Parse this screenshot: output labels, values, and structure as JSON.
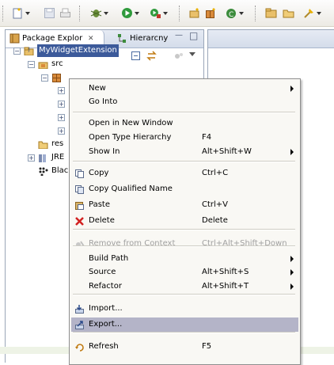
{
  "toolbar": {
    "icons": [
      "new-wizard-icon",
      "save-icon",
      "print-icon",
      "debug-icon",
      "run-icon",
      "external-tools-icon",
      "new-java-project-icon",
      "new-package-icon",
      "new-class-icon",
      "open-type-icon",
      "open-folder-icon",
      "search-icon"
    ]
  },
  "package_explorer": {
    "tab_label": "Package Explor",
    "close_glyph": "✕",
    "hierarchy_tab_label": "Hierarcny",
    "minimize_glyph": "—",
    "maximize_glyph": "□",
    "tree": [
      {
        "label": "MyWidgetExtension",
        "level": 0,
        "expander": "−",
        "icon": "project-icon"
      },
      {
        "label": "src",
        "level": 1,
        "expander": "−",
        "icon": "source-folder-icon"
      },
      {
        "label": "",
        "level": 2,
        "expander": "−",
        "icon": "package-icon"
      },
      {
        "label": "",
        "level": 3,
        "expander": "+",
        "icon": ""
      },
      {
        "label": "",
        "level": 3,
        "expander": "+",
        "icon": ""
      },
      {
        "label": "",
        "level": 3,
        "expander": "+",
        "icon": ""
      },
      {
        "label": "",
        "level": 3,
        "expander": "+",
        "icon": ""
      },
      {
        "label": "res",
        "level": 1,
        "expander": "",
        "icon": "folder-icon"
      },
      {
        "label": "JRE",
        "level": 1,
        "expander": "+",
        "icon": "library-icon"
      },
      {
        "label": "Blac",
        "level": 1,
        "expander": "",
        "icon": "blackberry-icon"
      }
    ]
  },
  "context_menu": {
    "items": [
      {
        "label": "New",
        "accel": "",
        "submenu": true
      },
      {
        "label": "Go Into",
        "accel": "",
        "submenu": false
      },
      {
        "label": "Open in New Window",
        "accel": "",
        "submenu": false
      },
      {
        "label": "Open Type Hierarchy",
        "accel": "F4",
        "submenu": false
      },
      {
        "label": "Show In",
        "accel": "Alt+Shift+W",
        "submenu": true
      },
      {
        "label": "Copy",
        "accel": "Ctrl+C",
        "submenu": false,
        "icon": "copy-icon"
      },
      {
        "label": "Copy Qualified Name",
        "accel": "",
        "submenu": false,
        "icon": "copy-qualified-name-icon"
      },
      {
        "label": "Paste",
        "accel": "Ctrl+V",
        "submenu": false,
        "icon": "paste-icon"
      },
      {
        "label": "Delete",
        "accel": "Delete",
        "submenu": false,
        "icon": "delete-icon"
      },
      {
        "label": "Remove from Context",
        "accel": "Ctrl+Alt+Shift+Down",
        "submenu": false,
        "icon": "remove-context-icon",
        "disabled": true
      },
      {
        "label": "Build Path",
        "accel": "",
        "submenu": true
      },
      {
        "label": "Source",
        "accel": "Alt+Shift+S",
        "submenu": true
      },
      {
        "label": "Refactor",
        "accel": "Alt+Shift+T",
        "submenu": true
      },
      {
        "label": "Import...",
        "accel": "",
        "submenu": false,
        "icon": "import-icon"
      },
      {
        "label": "Export...",
        "accel": "",
        "submenu": false,
        "icon": "export-icon",
        "selected": true
      },
      {
        "label": "Refresh",
        "accel": "F5",
        "submenu": false,
        "icon": "refresh-icon"
      }
    ]
  },
  "colors": {
    "menu_background": "#f9f8f4",
    "menu_selection": "#b4b4c8",
    "view_tab_gradient_top": "#e6ebf4",
    "selected_tree_item": "#3c5a9a"
  }
}
